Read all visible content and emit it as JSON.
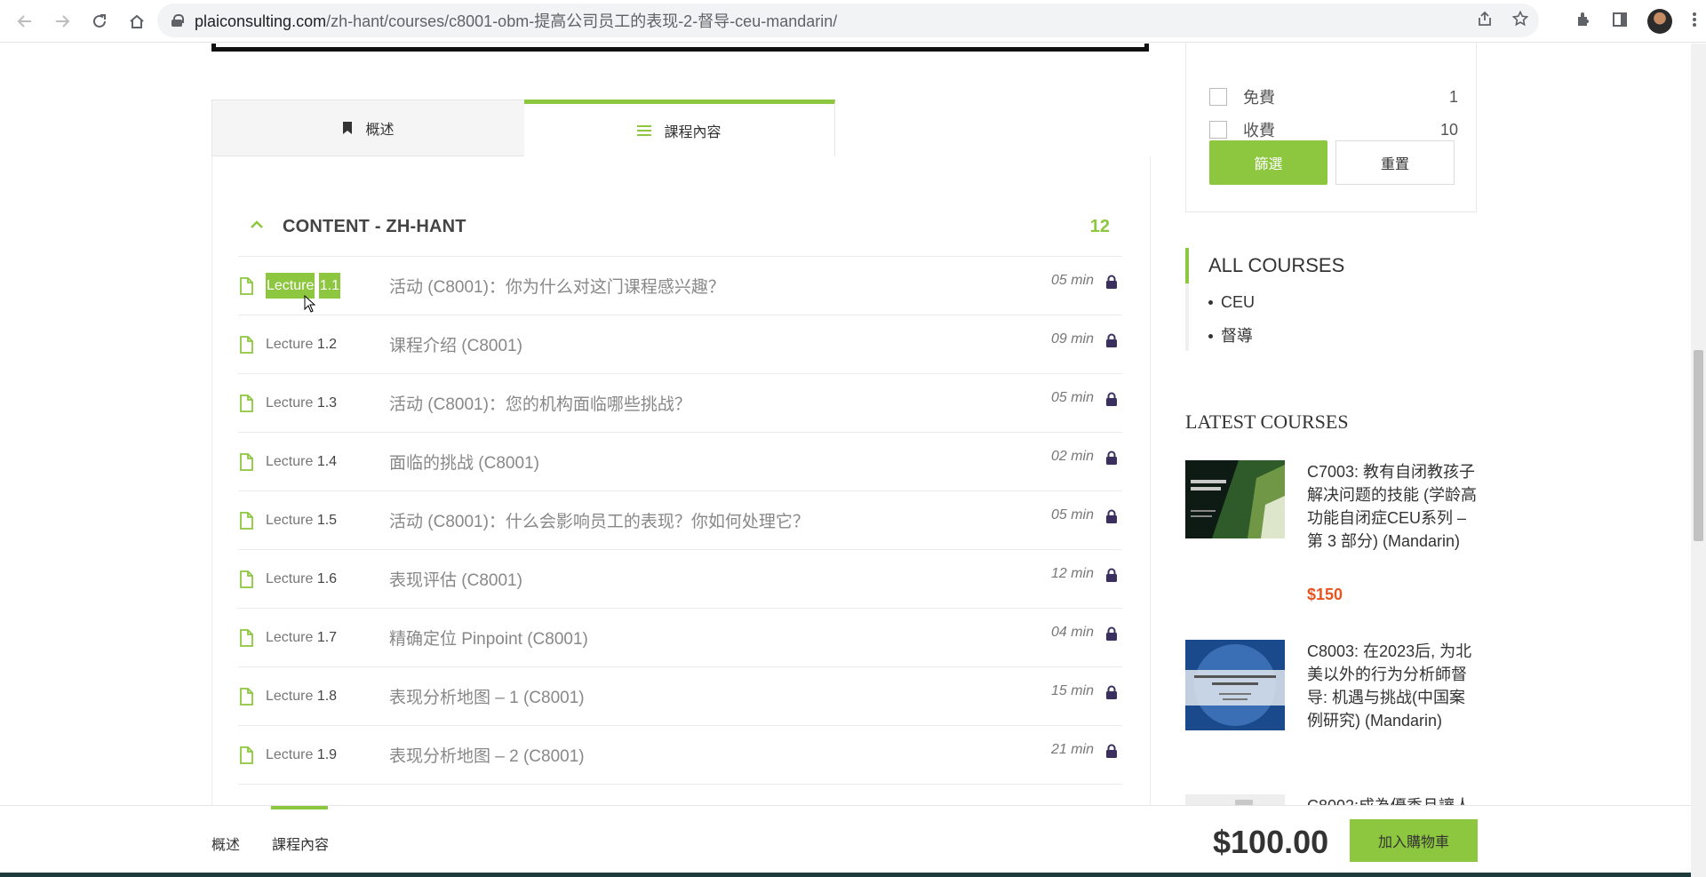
{
  "browser": {
    "url_host": "plaiconsulting.com",
    "url_path": "/zh-hant/courses/c8001-obm-提高公司员工的表现-2-督导-ceu-mandarin/"
  },
  "tabs": [
    {
      "label": "概述"
    },
    {
      "label": "課程內容"
    }
  ],
  "section": {
    "title": "CONTENT - ZH-HANT",
    "count": "12"
  },
  "lectures": [
    {
      "prefix": "Lecture",
      "num": "1.1",
      "title": "活动 (C8001)：你为什么对这门课程感兴趣？",
      "duration": "05 min"
    },
    {
      "prefix": "Lecture",
      "num": "1.2",
      "title": "课程介绍 (C8001)",
      "duration": "09 min"
    },
    {
      "prefix": "Lecture",
      "num": "1.3",
      "title": "活动 (C8001)：您的机构面临哪些挑战？",
      "duration": "05 min"
    },
    {
      "prefix": "Lecture",
      "num": "1.4",
      "title": "面临的挑战 (C8001)",
      "duration": "02 min"
    },
    {
      "prefix": "Lecture",
      "num": "1.5",
      "title": "活动 (C8001)：什么会影响员工的表现？你如何处理它？",
      "duration": "05 min"
    },
    {
      "prefix": "Lecture",
      "num": "1.6",
      "title": "表现评估 (C8001)",
      "duration": "12 min"
    },
    {
      "prefix": "Lecture",
      "num": "1.7",
      "title": "精确定位 Pinpoint (C8001)",
      "duration": "04 min"
    },
    {
      "prefix": "Lecture",
      "num": "1.8",
      "title": "表现分析地图 – 1 (C8001)",
      "duration": "15 min"
    },
    {
      "prefix": "Lecture",
      "num": "1.9",
      "title": "表现分析地图 – 2 (C8001)",
      "duration": "21 min"
    }
  ],
  "filters": {
    "options": [
      {
        "label": "免費",
        "count": "1"
      },
      {
        "label": "收費",
        "count": "10"
      }
    ],
    "filter_label": "篩選",
    "reset_label": "重置"
  },
  "all_courses": {
    "heading": "ALL COURSES",
    "items": [
      "CEU",
      "督導"
    ]
  },
  "latest": {
    "heading": "LATEST COURSES",
    "courses": [
      {
        "title": "C7003: 教有自闭教孩子解决问题的技能 (学龄高功能自闭症CEU系列 – 第 3 部分) (Mandarin)",
        "price": "$150"
      },
      {
        "title": "C8003: 在2023后, 为北美以外的行为分析師督导: 机遇与挑战(中国案例研究) (Mandarin)",
        "price": ""
      },
      {
        "title": "C8002:成為優秀且讓人",
        "price": ""
      }
    ]
  },
  "sticky": {
    "tab1": "概述",
    "tab2": "課程內容",
    "price": "$100.00",
    "cart_label": "加入購物車"
  },
  "colors": {
    "accent": "#8dc63f",
    "price": "#e8541e",
    "lock": "#3a2f5e"
  }
}
